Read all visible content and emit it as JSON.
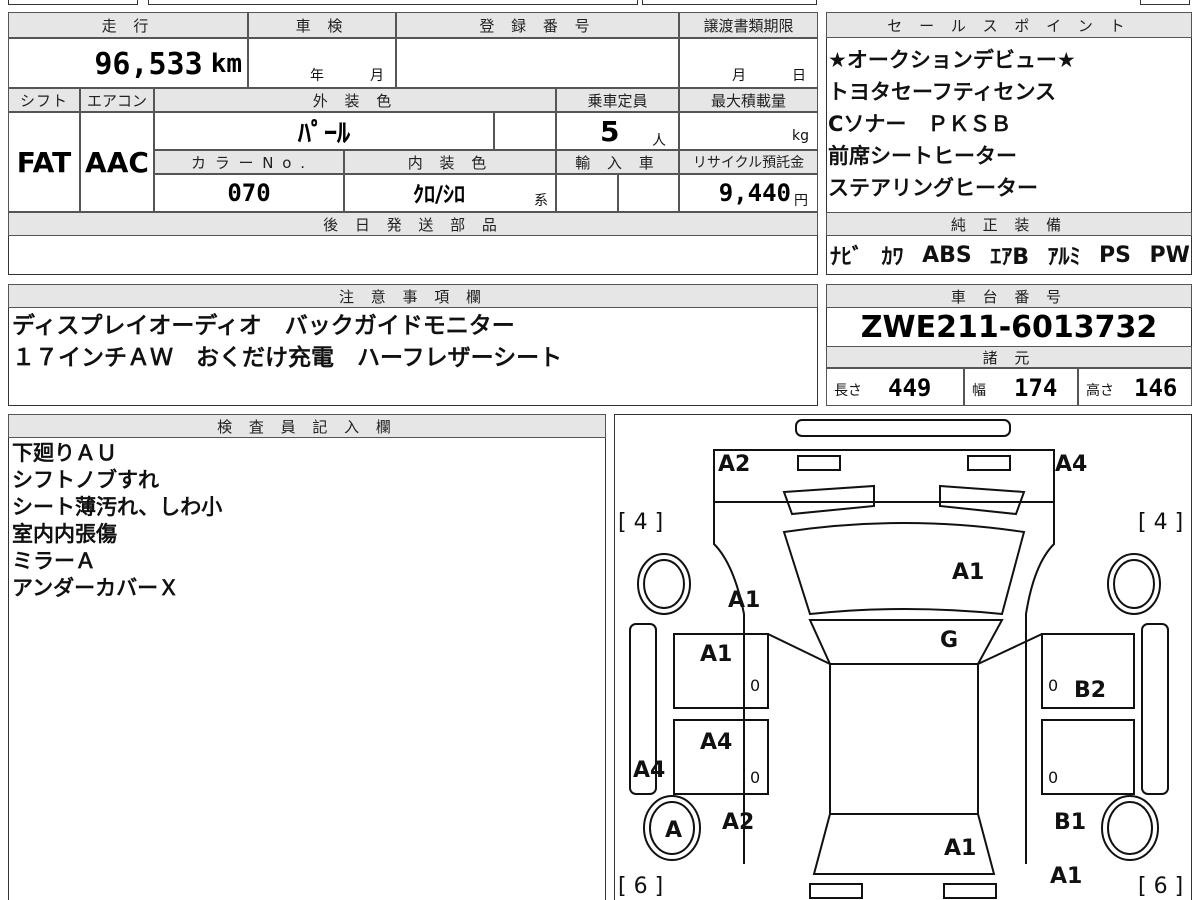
{
  "basic": {
    "mileage_label": "走 行",
    "mileage_value": "96,533",
    "mileage_unit": "km",
    "inspection_label": "車 検",
    "inspection_year": "年",
    "inspection_month": "月",
    "registration_label": "登 録 番 号",
    "transfer_label": "譲渡書類期限",
    "transfer_month": "月",
    "transfer_day": "日",
    "shift_label": "シフト",
    "shift_value": "FAT",
    "ac_label": "エアコン",
    "ac_value": "AAC",
    "exterior_label": "外 装 色",
    "exterior_value": "ﾊﾟｰﾙ",
    "capacity_label": "乗車定員",
    "capacity_value": "5",
    "capacity_unit": "人",
    "load_label": "最大積載量",
    "load_unit": "kg",
    "color_no_label": "カ ラ ー N o .",
    "color_no_value": "070",
    "interior_label": "内 装 色",
    "interior_value": "ｸﾛ/ｼﾛ",
    "interior_suffix": "系",
    "import_label": "輸 入 車",
    "recycle_label": "リサイクル預託金",
    "recycle_value": "9,440",
    "recycle_unit": "円",
    "later_parts_label": "後 日 発 送 部 品"
  },
  "sales": {
    "label": "セ ー ル ス ポ イ ン ト",
    "points": [
      "★オークションデビュー★",
      "トヨタセーフティセンス",
      "Cソナー　ＰＫＳＢ",
      "前席シートヒーター",
      "ステアリングヒーター"
    ]
  },
  "equipment": {
    "label": "純 正 装 備",
    "items": [
      "ﾅﾋﾞ",
      "ｶﾜ",
      "ABS",
      "ｴｱB",
      "ｱﾙﾐ",
      "PS",
      "PW"
    ]
  },
  "notes": {
    "label": "注 意 事 項 欄",
    "lines": [
      "ディスプレイオーディオ　バックガイドモニター",
      "１７インチＡＷ　おくだけ充電　ハーフレザーシート"
    ]
  },
  "chassis": {
    "label": "車 台 番 号",
    "value": "ZWE211-6013732"
  },
  "specs": {
    "label": "諸 元",
    "length_label": "長さ",
    "length_value": "449",
    "width_label": "幅",
    "width_value": "174",
    "height_label": "高さ",
    "height_value": "146"
  },
  "inspector": {
    "label": "検 査 員 記 入 欄",
    "lines": [
      "下廻りＡＵ",
      "シフトノブすれ",
      "シート薄汚れ、しわ小",
      "室内内張傷",
      "ミラーＡ",
      "アンダーカバーＸ"
    ]
  },
  "diagram": {
    "marks": {
      "top_left": "A2",
      "top_right": "A4",
      "tire_fl": "[ 4 ]",
      "tire_fr": "[ 4 ]",
      "tire_rl": "[ 6 ]",
      "tire_rr": "[ 6 ]",
      "hood": "A1",
      "front_left": "A1",
      "windshield": "G",
      "front_door_left": "A1",
      "rear_door_left": "A4",
      "sill_left": "A4",
      "rear_wheel_left": "A",
      "rear_left_fender": "A2",
      "rear_right_door": "B2",
      "rear_right_fender": "B1",
      "roof_rear": "A1",
      "rear_bottom_right": "A1",
      "zero_fl": "0",
      "zero_rl": "0",
      "zero_fr": "0",
      "zero_rr": "0"
    }
  }
}
